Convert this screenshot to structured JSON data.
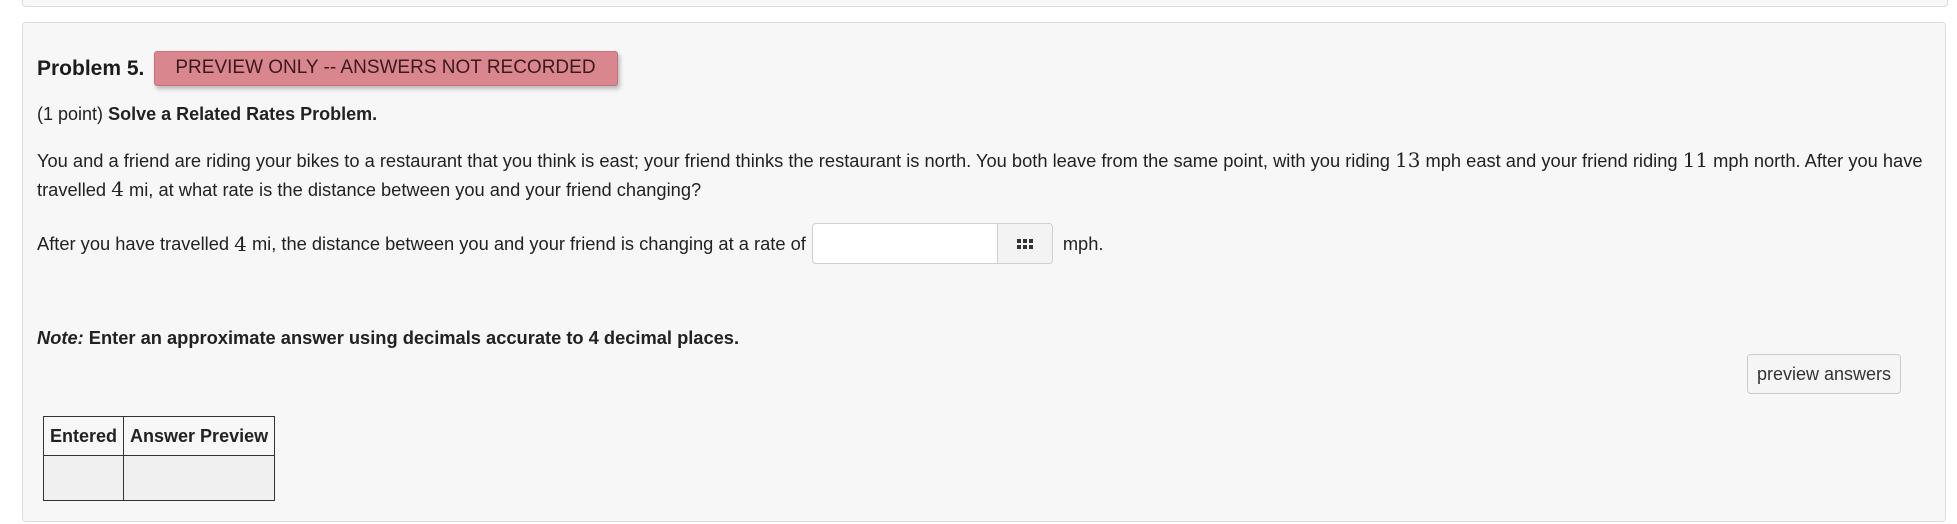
{
  "problem": {
    "title": "Problem 5.",
    "preview_badge": "PREVIEW ONLY -- ANSWERS NOT RECORDED",
    "points": "(1 point)",
    "heading": "Solve a Related Rates Problem.",
    "statement": {
      "part1": "You and a friend are riding your bikes to a restaurant that you think is east; your friend thinks the restaurant is north. You both leave from the same point, with you riding ",
      "speed_you": "13",
      "part2": " mph east and your friend riding ",
      "speed_friend": "11",
      "part3": " mph north. After you have travelled ",
      "distance": "4",
      "part4": " mi, at what rate is the distance between you and your friend changing?"
    },
    "answer_line": {
      "prefix": "After you have travelled ",
      "distance": "4",
      "middle": " mi, the distance between you and your friend is changing at a rate of",
      "input_value": "",
      "unit": "mph.",
      "equation_editor_icon": "grid-icon"
    },
    "note": {
      "label": "Note:",
      "text": " Enter an approximate answer using decimals accurate to 4 decimal places."
    },
    "preview_button_label": "preview answers",
    "results_table": {
      "headers": [
        "Entered",
        "Answer Preview"
      ],
      "rows": [
        [
          "",
          ""
        ]
      ]
    }
  },
  "colors": {
    "badge_background": "#d9868f",
    "panel_background": "#f7f7f8"
  }
}
